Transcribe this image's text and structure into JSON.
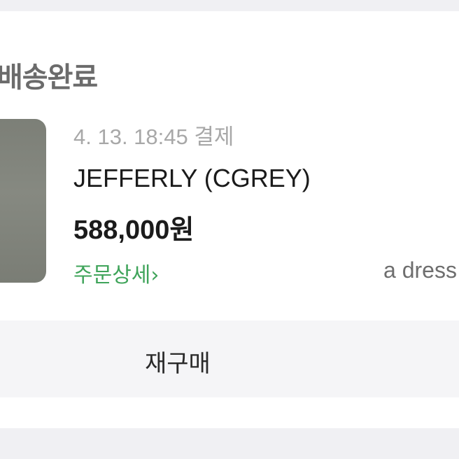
{
  "order": {
    "status": "배송완료",
    "paid_at": "4. 13. 18:45 결제",
    "product_name": "JEFFERLY (CGREY)",
    "price": "588,000원",
    "detail_link": "주문상세",
    "detail_chevron": "›",
    "store_name": "a dress"
  },
  "actions": {
    "rebuy_label": "재구매"
  }
}
